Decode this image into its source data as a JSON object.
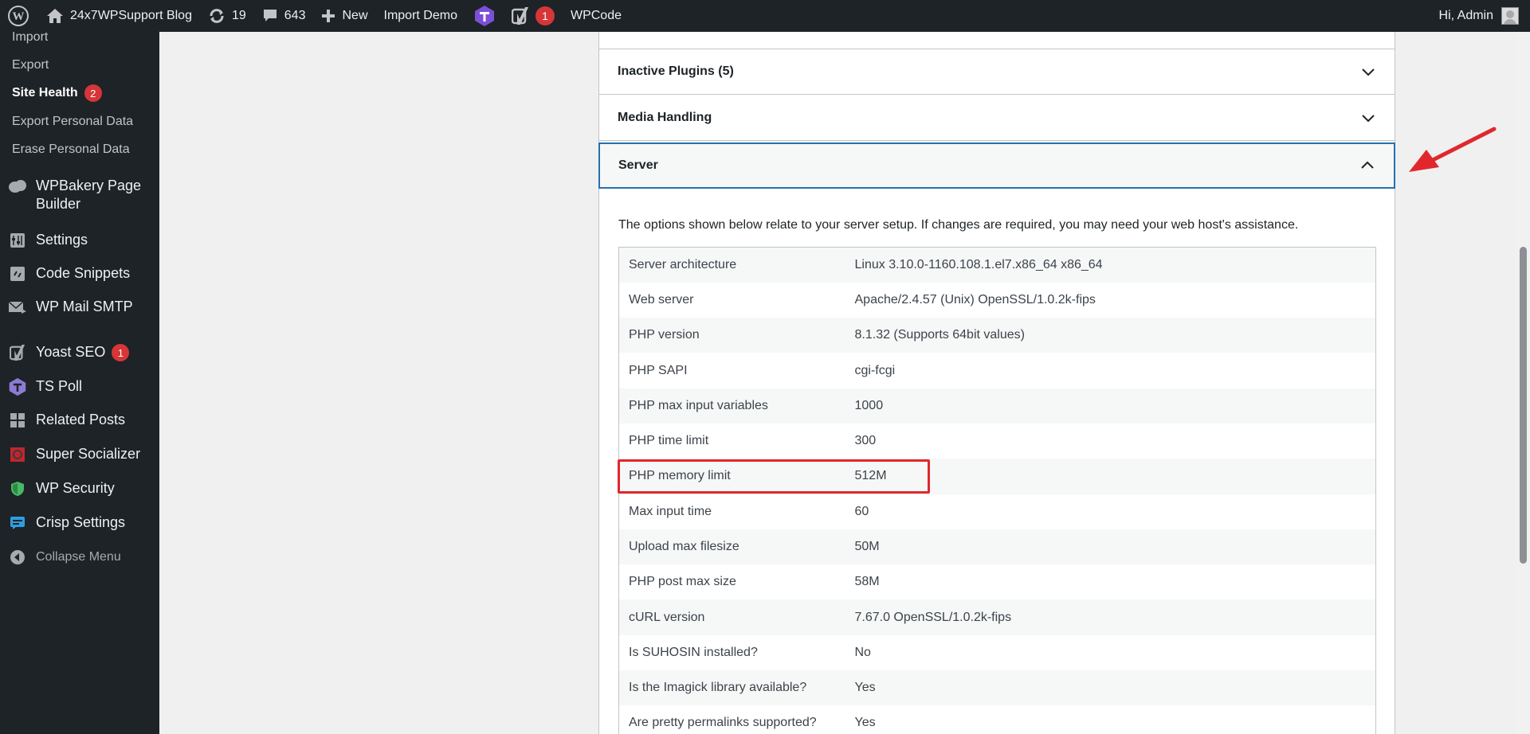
{
  "adminbar": {
    "site_name": "24x7WPSupport Blog",
    "updates_count": "19",
    "comments_count": "643",
    "new_label": "New",
    "import_demo_label": "Import Demo",
    "yoast_badge": "1",
    "wpcode_label": "WPCode",
    "greeting": "Hi, Admin"
  },
  "sidebar": {
    "sub_items": [
      {
        "label": "Import"
      },
      {
        "label": "Export"
      },
      {
        "label": "Site Health",
        "badge": "2"
      },
      {
        "label": "Export Personal Data"
      },
      {
        "label": "Erase Personal Data"
      }
    ],
    "menu": [
      {
        "label": "WPBakery Page Builder",
        "icon": "wpbakery-icon"
      },
      {
        "label": "Settings",
        "icon": "settings-icon"
      },
      {
        "label": "Code Snippets",
        "icon": "code-snippets-icon"
      },
      {
        "label": "WP Mail SMTP",
        "icon": "mail-icon"
      },
      {
        "label": "Yoast SEO",
        "icon": "yoast-icon",
        "badge": "1"
      },
      {
        "label": "TS Poll",
        "icon": "poll-icon"
      },
      {
        "label": "Related Posts",
        "icon": "grid-icon"
      },
      {
        "label": "Super Socializer",
        "icon": "socializer-icon"
      },
      {
        "label": "WP Security",
        "icon": "shield-icon"
      },
      {
        "label": "Crisp Settings",
        "icon": "chat-icon"
      },
      {
        "label": "Collapse Menu",
        "icon": "collapse-icon"
      }
    ]
  },
  "accordions": {
    "inactive_plugins": "Inactive Plugins (5)",
    "media_handling": "Media Handling",
    "server": "Server"
  },
  "server": {
    "intro": "The options shown below relate to your server setup. If changes are required, you may need your web host's assistance.",
    "rows": [
      {
        "key": "Server architecture",
        "value": "Linux 3.10.0-1160.108.1.el7.x86_64 x86_64"
      },
      {
        "key": "Web server",
        "value": "Apache/2.4.57 (Unix) OpenSSL/1.0.2k-fips"
      },
      {
        "key": "PHP version",
        "value": "8.1.32 (Supports 64bit values)"
      },
      {
        "key": "PHP SAPI",
        "value": "cgi-fcgi"
      },
      {
        "key": "PHP max input variables",
        "value": "1000"
      },
      {
        "key": "PHP time limit",
        "value": "300"
      },
      {
        "key": "PHP memory limit",
        "value": "512M"
      },
      {
        "key": "Max input time",
        "value": "60"
      },
      {
        "key": "Upload max filesize",
        "value": "50M"
      },
      {
        "key": "PHP post max size",
        "value": "58M"
      },
      {
        "key": "cURL version",
        "value": "7.67.0 OpenSSL/1.0.2k-fips"
      },
      {
        "key": "Is SUHOSIN installed?",
        "value": "No"
      },
      {
        "key": "Is the Imagick library available?",
        "value": "Yes"
      },
      {
        "key": "Are pretty permalinks supported?",
        "value": "Yes"
      }
    ]
  },
  "colors": {
    "adminbar_bg": "#1d2327",
    "badge_red": "#d63638",
    "focus_blue": "#2271b1",
    "annotation_red": "#e0282c"
  }
}
